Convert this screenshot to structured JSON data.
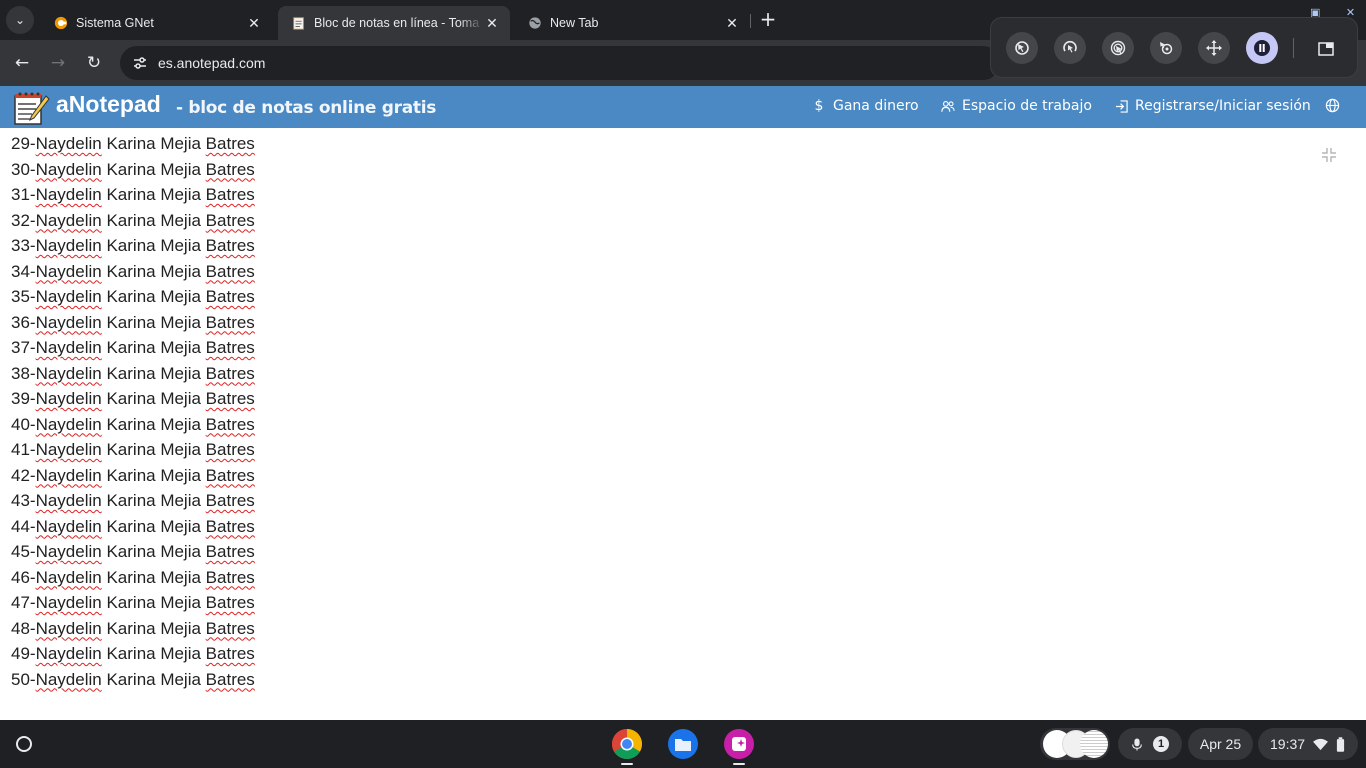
{
  "tabs": [
    {
      "title": "Sistema GNet",
      "favicon": "gnet-favicon",
      "active": false
    },
    {
      "title": "Bloc de notas en línea - Toma y",
      "favicon": "notepad-favicon",
      "active": true
    },
    {
      "title": "New Tab",
      "favicon": "globe-favicon",
      "active": false
    }
  ],
  "omnibox": {
    "url": "es.anotepad.com"
  },
  "site": {
    "brand": "aNotepad",
    "tagline": "- bloc de notas online gratis",
    "nav": {
      "earn": "Gana dinero",
      "workspace": "Espacio de trabajo",
      "login": "Registrarse/Iniciar sesión"
    }
  },
  "editor": {
    "lines": [
      {
        "num": "29-",
        "first": "Naydelin",
        "middle": " Karina Mejia ",
        "last": "Batres"
      },
      {
        "num": "30-",
        "first": "Naydelin",
        "middle": " Karina Mejia ",
        "last": "Batres"
      },
      {
        "num": "31-",
        "first": "Naydelin",
        "middle": " Karina Mejia ",
        "last": "Batres"
      },
      {
        "num": "32-",
        "first": "Naydelin",
        "middle": " Karina Mejia ",
        "last": "Batres"
      },
      {
        "num": "33-",
        "first": "Naydelin",
        "middle": " Karina Mejia ",
        "last": "Batres"
      },
      {
        "num": "34-",
        "first": "Naydelin",
        "middle": " Karina Mejia ",
        "last": "Batres"
      },
      {
        "num": "35-",
        "first": "Naydelin",
        "middle": " Karina Mejia ",
        "last": "Batres"
      },
      {
        "num": "36-",
        "first": "Naydelin",
        "middle": " Karina Mejia ",
        "last": "Batres"
      },
      {
        "num": "37-",
        "first": "Naydelin",
        "middle": " Karina Mejia ",
        "last": "Batres"
      },
      {
        "num": "38-",
        "first": "Naydelin",
        "middle": " Karina Mejia ",
        "last": "Batres"
      },
      {
        "num": "39-",
        "first": "Naydelin",
        "middle": " Karina Mejia ",
        "last": "Batres"
      },
      {
        "num": "40-",
        "first": "Naydelin",
        "middle": " Karina Mejia ",
        "last": "Batres"
      },
      {
        "num": "41-",
        "first": "Naydelin",
        "middle": " Karina Mejia ",
        "last": "Batres"
      },
      {
        "num": "42-",
        "first": "Naydelin",
        "middle": " Karina Mejia ",
        "last": "Batres"
      },
      {
        "num": "43-",
        "first": "Naydelin",
        "middle": " Karina Mejia ",
        "last": "Batres"
      },
      {
        "num": "44-",
        "first": "Naydelin",
        "middle": " Karina Mejia ",
        "last": "Batres"
      },
      {
        "num": "45-",
        "first": "Naydelin",
        "middle": " Karina Mejia ",
        "last": "Batres"
      },
      {
        "num": "46-",
        "first": "Naydelin",
        "middle": " Karina Mejia ",
        "last": "Batres"
      },
      {
        "num": "47-",
        "first": "Naydelin",
        "middle": " Karina Mejia ",
        "last": "Batres"
      },
      {
        "num": "48-",
        "first": "Naydelin",
        "middle": " Karina Mejia ",
        "last": "Batres"
      },
      {
        "num": "49-",
        "first": "Naydelin",
        "middle": " Karina Mejia ",
        "last": "Batres"
      },
      {
        "num": "50-",
        "first": "Naydelin",
        "middle": " Karina Mejia ",
        "last": "Batres"
      }
    ]
  },
  "shelf": {
    "notification_count": "1",
    "date": "Apr 25",
    "time": "19:37"
  },
  "colors": {
    "site_header": "#4a89c4",
    "spell_underline": "#e02020",
    "pause_button": "#c5c8f5"
  }
}
